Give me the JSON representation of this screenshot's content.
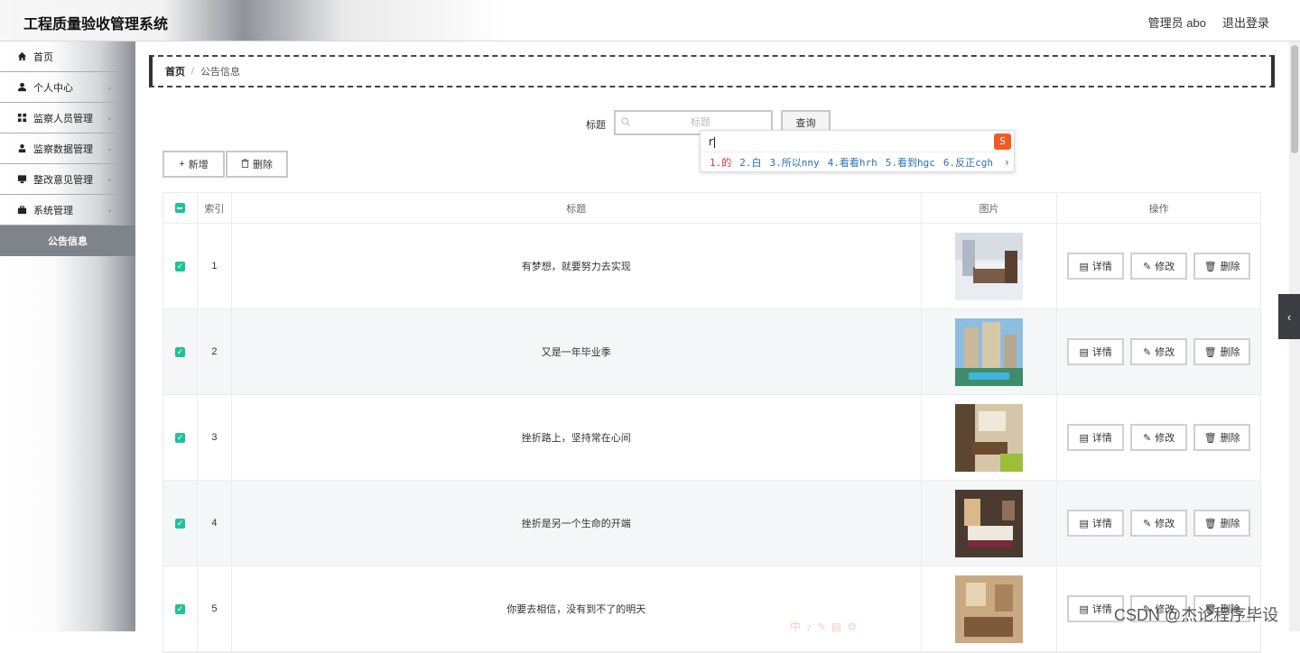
{
  "header": {
    "title": "工程质量验收管理系统",
    "user": "管理员 abo",
    "logout": "退出登录"
  },
  "sidebar": {
    "items": [
      {
        "label": "首页",
        "icon": "home-icon"
      },
      {
        "label": "个人中心",
        "icon": "user-icon"
      },
      {
        "label": "监察人员管理",
        "icon": "grid-icon"
      },
      {
        "label": "监察数据管理",
        "icon": "person-icon"
      },
      {
        "label": "整改意见管理",
        "icon": "monitor-icon"
      },
      {
        "label": "系统管理",
        "icon": "briefcase-icon"
      }
    ],
    "active": "公告信息"
  },
  "breadcrumb": {
    "home": "首页",
    "separator": "/",
    "current": "公告信息"
  },
  "search": {
    "label": "标题",
    "placeholder": "标题",
    "button": "查询"
  },
  "ime": {
    "input": "r",
    "candidates": [
      "1.的",
      "2.白",
      "3.所以nny",
      "4.看看hrh",
      "5.看到hgc",
      "6.反正cgh"
    ]
  },
  "toolbar": {
    "add": "新增",
    "delete": "删除"
  },
  "table": {
    "headers": {
      "index": "索引",
      "title": "标题",
      "image": "图片",
      "actions": "操作"
    },
    "rows": [
      {
        "index": "1",
        "title": "有梦想，就要努力去实现"
      },
      {
        "index": "2",
        "title": "又是一年毕业季"
      },
      {
        "index": "3",
        "title": "挫折路上，坚持常在心间"
      },
      {
        "index": "4",
        "title": "挫折是另一个生命的开端"
      },
      {
        "index": "5",
        "title": "你要去相信，没有到不了的明天"
      }
    ],
    "actions": {
      "detail": "详情",
      "edit": "修改",
      "delete": "删除"
    }
  },
  "watermark": "CSDN @杰论程序毕设",
  "colors": {
    "accent": "#1fc29a",
    "active_menu": "#7f848a"
  }
}
